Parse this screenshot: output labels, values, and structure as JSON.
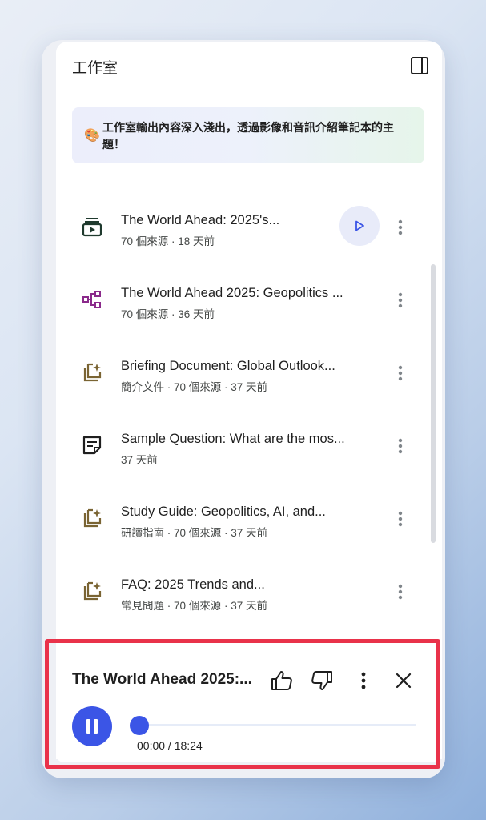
{
  "header": {
    "title": "工作室"
  },
  "banner": {
    "emoji": "🎨",
    "text": "工作室輸出內容深入淺出，透過影像和音訊介紹筆記本的主題！"
  },
  "items": [
    {
      "icon": "video-overview-icon",
      "title": "The World Ahead: 2025's...",
      "subtitle": "70 個來源 · 18 天前",
      "has_play": true
    },
    {
      "icon": "mind-map-icon",
      "title": "The World Ahead 2025: Geopolitics ...",
      "subtitle": "70 個來源 · 36 天前",
      "has_play": false
    },
    {
      "icon": "report-icon",
      "title": "Briefing Document: Global Outlook...",
      "subtitle": "簡介文件 · 70 個來源 · 37 天前",
      "has_play": false
    },
    {
      "icon": "note-icon",
      "title": "Sample Question: What are the mos...",
      "subtitle": "37 天前",
      "has_play": false
    },
    {
      "icon": "report-icon",
      "title": "Study Guide: Geopolitics, AI, and...",
      "subtitle": "研讀指南 · 70 個來源 · 37 天前",
      "has_play": false
    },
    {
      "icon": "report-icon",
      "title": "FAQ: 2025 Trends and...",
      "subtitle": "常見問題 · 70 個來源 · 37 天前",
      "has_play": false
    }
  ],
  "player": {
    "title": "The World Ahead 2025:...",
    "current_time": "00:00",
    "duration": "18:24",
    "time_display": "00:00 / 18:24",
    "progress": 0
  },
  "colors": {
    "accent": "#3b55e6",
    "highlight": "#e9324a",
    "mind_map": "#8b2a8b",
    "report": "#7a6433"
  }
}
